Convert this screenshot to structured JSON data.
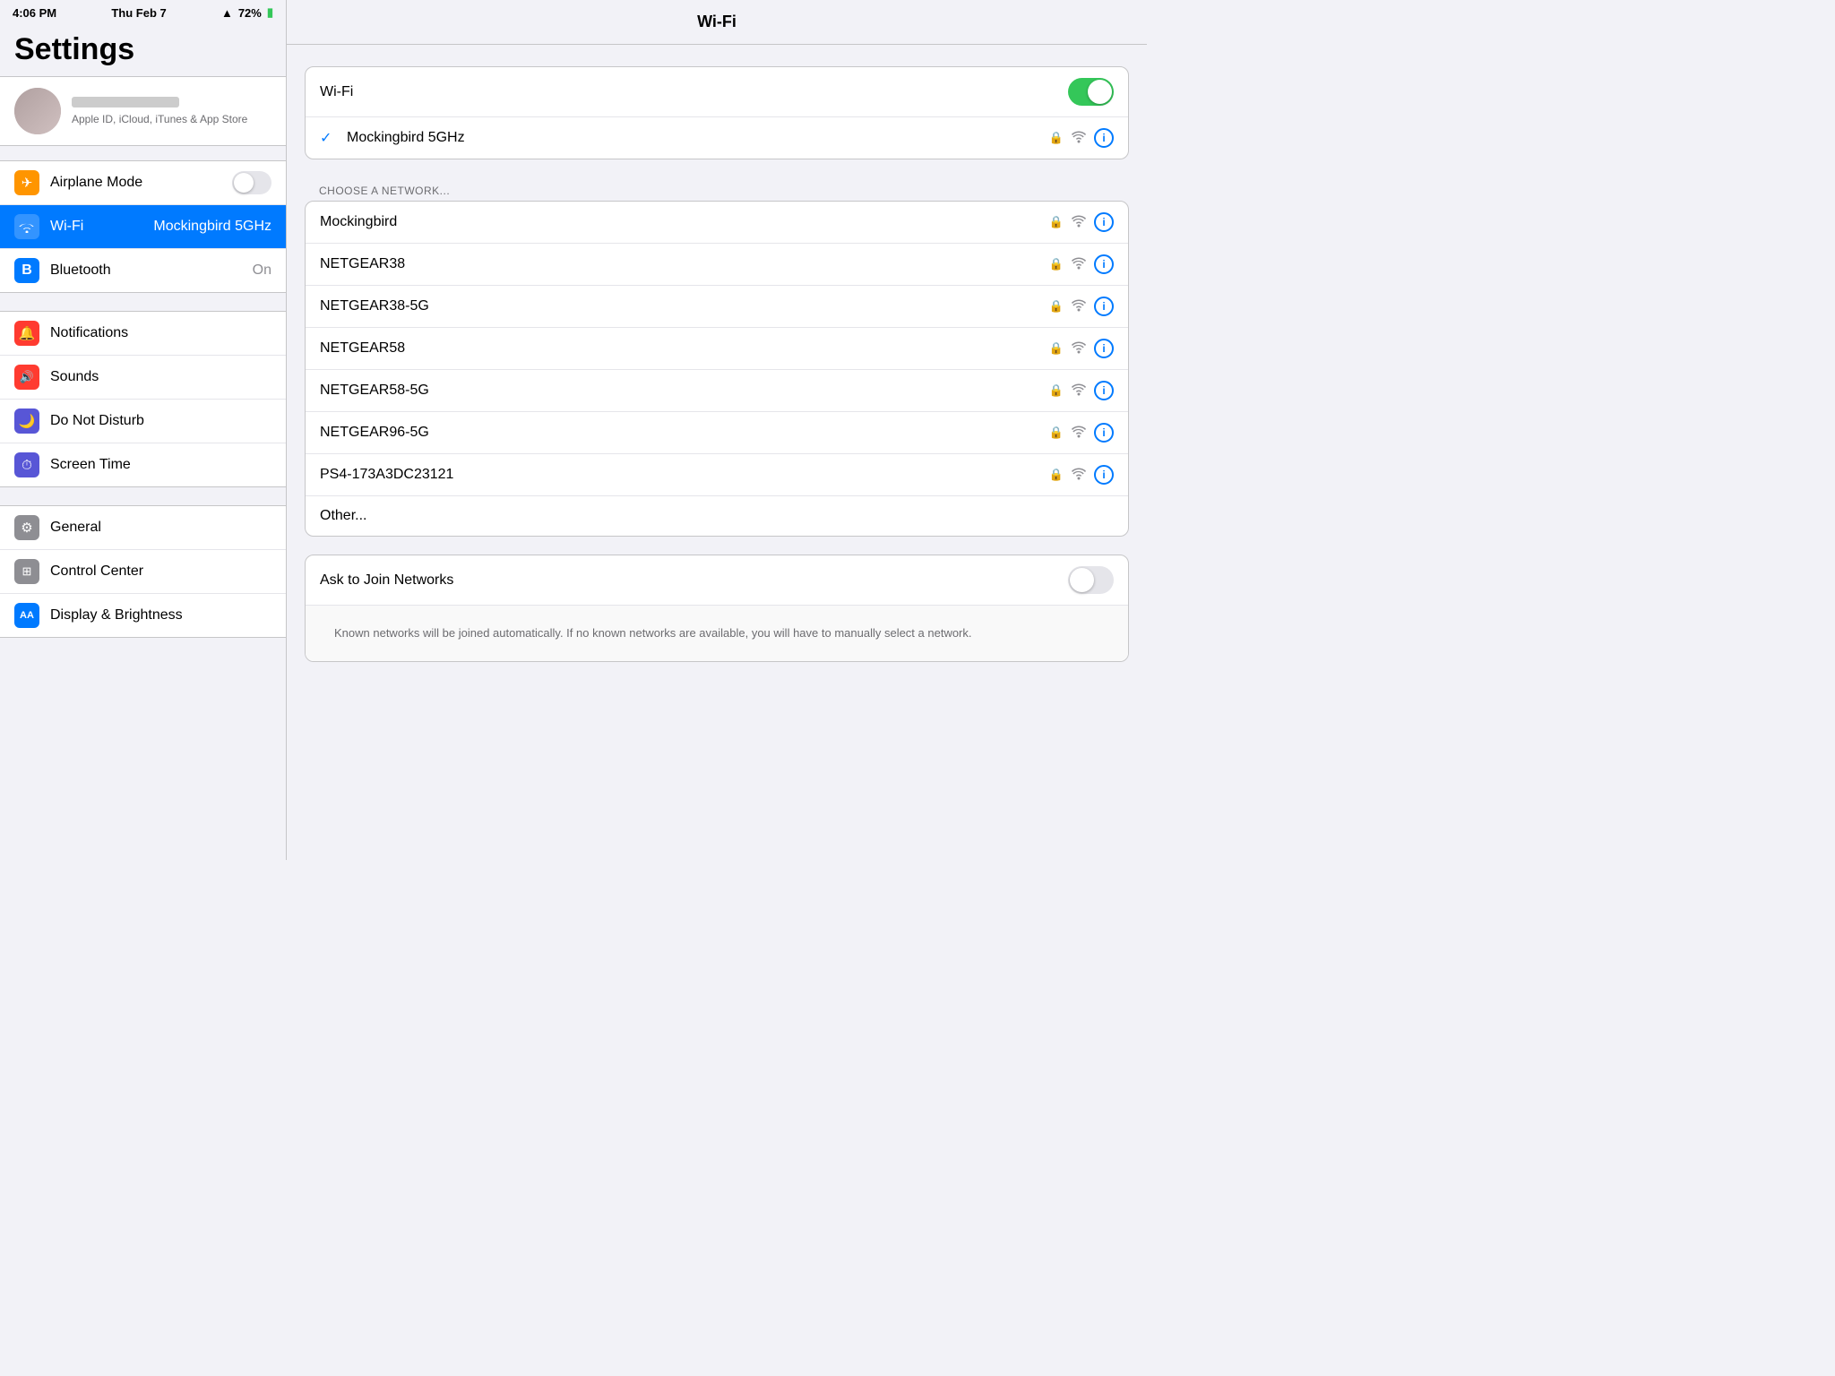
{
  "statusBar": {
    "time": "4:06 PM",
    "date": "Thu Feb 7",
    "battery": "72%"
  },
  "sidebar": {
    "title": "Settings",
    "profile": {
      "subtitle": "Apple ID, iCloud, iTunes & App Store"
    },
    "groups": [
      {
        "items": [
          {
            "id": "airplane",
            "label": "Airplane Mode",
            "iconClass": "icon-airplane",
            "iconSymbol": "✈",
            "type": "toggle",
            "value": false
          },
          {
            "id": "wifi",
            "label": "Wi-Fi",
            "iconClass": "icon-wifi",
            "iconSymbol": "📶",
            "type": "value",
            "value": "Mockingbird 5GHz",
            "active": true
          },
          {
            "id": "bluetooth",
            "label": "Bluetooth",
            "iconClass": "icon-bluetooth",
            "iconSymbol": "◈",
            "type": "value",
            "value": "On"
          }
        ]
      },
      {
        "items": [
          {
            "id": "notifications",
            "label": "Notifications",
            "iconClass": "icon-notifications",
            "iconSymbol": "🔔",
            "type": "nav"
          },
          {
            "id": "sounds",
            "label": "Sounds",
            "iconClass": "icon-sounds",
            "iconSymbol": "🔊",
            "type": "nav"
          },
          {
            "id": "dnd",
            "label": "Do Not Disturb",
            "iconClass": "icon-dnd",
            "iconSymbol": "🌙",
            "type": "nav"
          },
          {
            "id": "screentime",
            "label": "Screen Time",
            "iconClass": "icon-screentime",
            "iconSymbol": "⏱",
            "type": "nav"
          }
        ]
      },
      {
        "items": [
          {
            "id": "general",
            "label": "General",
            "iconClass": "icon-general",
            "iconSymbol": "⚙",
            "type": "nav"
          },
          {
            "id": "controlcenter",
            "label": "Control Center",
            "iconClass": "icon-controlcenter",
            "iconSymbol": "⊞",
            "type": "nav"
          },
          {
            "id": "display",
            "label": "Display & Brightness",
            "iconClass": "icon-display",
            "iconSymbol": "AA",
            "type": "nav"
          }
        ]
      }
    ]
  },
  "mainPanel": {
    "title": "Wi-Fi",
    "wifiToggle": true,
    "connectedNetwork": "Mockingbird 5GHz",
    "sectionHeader": "CHOOSE A NETWORK...",
    "networks": [
      {
        "name": "Mockingbird",
        "locked": true,
        "signal": 3
      },
      {
        "name": "NETGEAR38",
        "locked": true,
        "signal": 3
      },
      {
        "name": "NETGEAR38-5G",
        "locked": true,
        "signal": 3
      },
      {
        "name": "NETGEAR58",
        "locked": true,
        "signal": 3
      },
      {
        "name": "NETGEAR58-5G",
        "locked": true,
        "signal": 3
      },
      {
        "name": "NETGEAR96-5G",
        "locked": true,
        "signal": 3
      },
      {
        "name": "PS4-173A3DC23121",
        "locked": true,
        "signal": 3
      },
      {
        "name": "Other...",
        "locked": false,
        "signal": 0
      }
    ],
    "askToJoin": {
      "label": "Ask to Join Networks",
      "value": false,
      "notice": "Known networks will be joined automatically. If no known networks are available, you will have to manually select a network."
    }
  }
}
